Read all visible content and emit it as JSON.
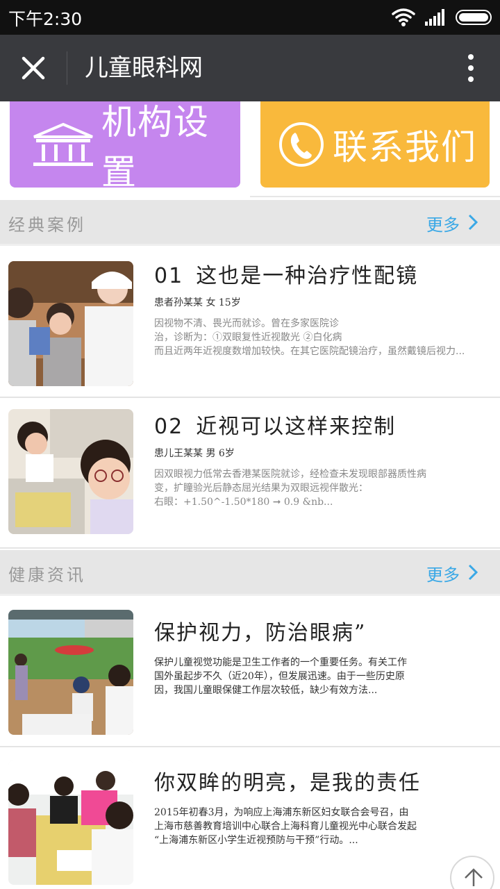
{
  "status_bar": {
    "time": "下午2:30",
    "icons": [
      "wifi-icon",
      "signal-icon",
      "battery-icon"
    ]
  },
  "title_bar": {
    "title": "儿童眼科网",
    "close_icon": "close-icon",
    "more_icon": "more-vertical-icon"
  },
  "tiles": [
    {
      "label": "机构设置",
      "icon": "institution-icon",
      "color": "#c586ee"
    },
    {
      "label": "联系我们",
      "icon": "phone-icon",
      "color": "#f9b93c"
    }
  ],
  "sections": [
    {
      "title": "经典案例",
      "more": "更多",
      "items": [
        {
          "num": "01",
          "title": "这也是一种治疗性配镜",
          "meta": "患者孙某某 女 15岁",
          "desc": [
            "因视物不清、畏光而就诊。曾在多家医院诊",
            "治，诊断为：①双眼复性近视散光 ②白化病",
            "而且近两年近视度数增加较快。在其它医院配镜治疗，虽然戴镜后视力..."
          ]
        },
        {
          "num": "02",
          "title": "近视可以这样来控制",
          "meta": "患儿王某某 男 6岁",
          "desc": [
            "因双眼视力低常去香港某医院就诊，经检查未发现眼部器质性病",
            "变，扩瞳验光后静态屈光结果为双眼远视伴散光：",
            "右眼：+1.50^-1.50*180 ➞ 0.9 &nb..."
          ]
        }
      ]
    },
    {
      "title": "健康资讯",
      "more": "更多",
      "items": [
        {
          "title": "保护视力，防治眼病”",
          "desc": [
            "保护儿童视觉功能是卫生工作者的一个重要任务。有关工作",
            "国外虽起步不久（近20年），但发展迅速。由于一些历史原",
            "因，我国儿童眼保健工作层次较低，缺少有效方法..."
          ]
        },
        {
          "title": "你双眸的明亮，是我的责任",
          "desc": [
            "2015年初春3月，为响应上海浦东新区妇女联合会号召，由",
            "上海市慈善教育培训中心联合上海科育儿童视光中心联合发起",
            "“上海浦东新区小学生近视预防与干预”行动。..."
          ]
        }
      ]
    }
  ],
  "scroll_top_icon": "arrow-up-icon"
}
